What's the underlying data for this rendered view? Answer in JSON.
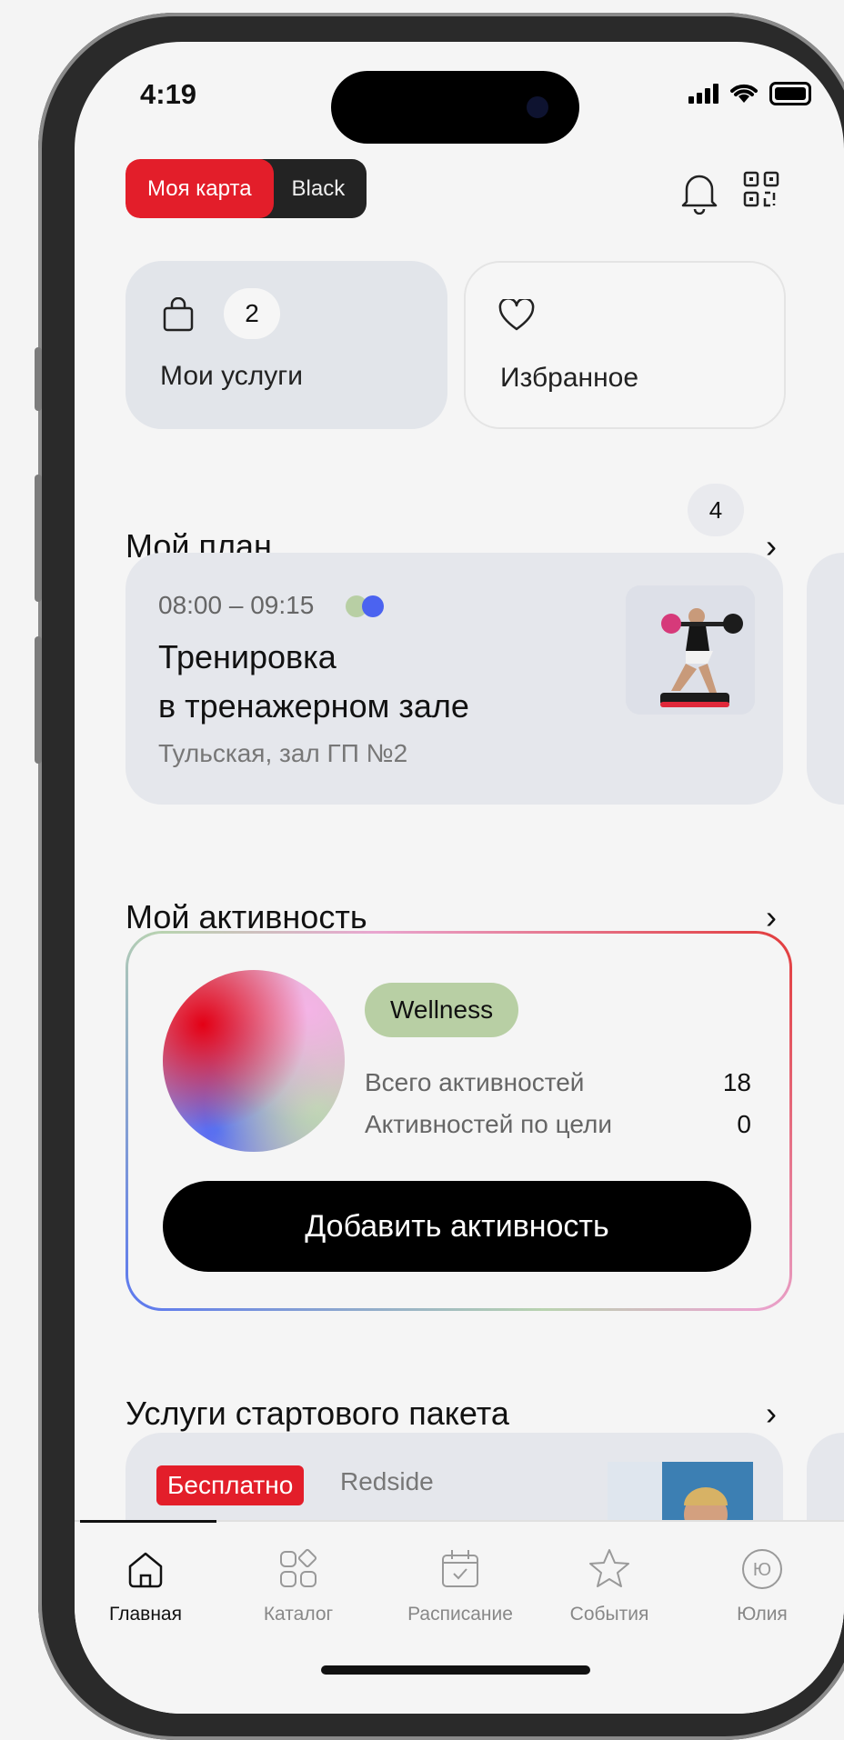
{
  "status_bar": {
    "time": "4:19"
  },
  "header": {
    "card_toggle": {
      "active": "Моя карта",
      "inactive": "Black"
    },
    "bell_icon": "bell-icon",
    "qr_icon": "qr-code-icon"
  },
  "tiles": {
    "services": {
      "label": "Мои услуги",
      "count": "2",
      "icon": "shopping-bag-icon"
    },
    "favorites": {
      "label": "Избранное",
      "icon": "heart-icon"
    }
  },
  "plan": {
    "title": "Мой план",
    "count": "4",
    "card": {
      "time": "08:00 – 09:15",
      "title_line1": "Тренировка",
      "title_line2": "в тренажерном зале",
      "location": "Тульская, зал ГП №2"
    }
  },
  "activity": {
    "title": "Мой активность",
    "badge": "Wellness",
    "stats": [
      {
        "label": "Всего активностей",
        "value": "18"
      },
      {
        "label": "Активностей по цели",
        "value": "0"
      }
    ],
    "add_button": "Добавить активность"
  },
  "starter": {
    "title": "Услуги стартового пакета",
    "card": {
      "badge": "Бесплатно",
      "brand": "Redside"
    }
  },
  "tabbar": {
    "items": [
      {
        "label": "Главная",
        "icon": "home-icon",
        "active": true
      },
      {
        "label": "Каталог",
        "icon": "catalog-icon",
        "active": false
      },
      {
        "label": "Расписание",
        "icon": "calendar-icon",
        "active": false
      },
      {
        "label": "События",
        "icon": "star-icon",
        "active": false
      },
      {
        "label": "Юлия",
        "icon": "avatar-icon",
        "active": false
      }
    ],
    "avatar_initials": "Ю"
  },
  "colors": {
    "accent_red": "#e31e2a",
    "wellness_green": "#b8cfa4",
    "card_bg": "#e5e7ec"
  }
}
